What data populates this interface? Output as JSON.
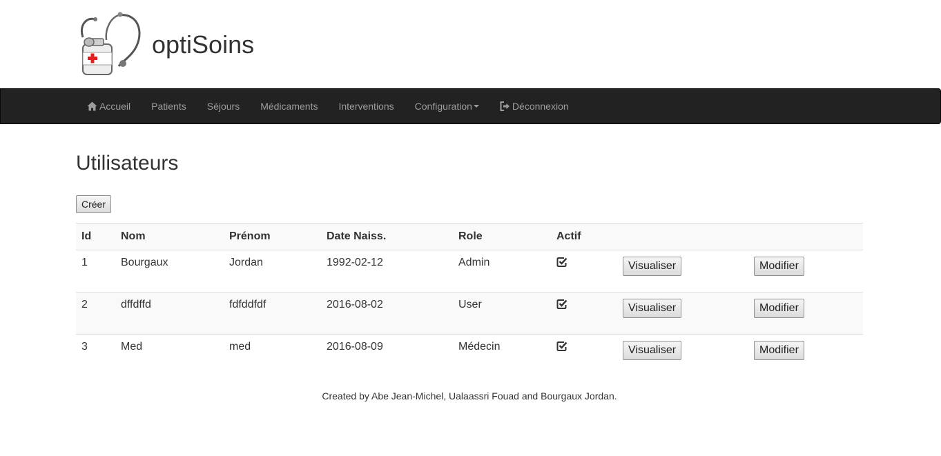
{
  "brand": {
    "name": "optiSoins"
  },
  "nav": {
    "items": [
      {
        "label": "Accueil",
        "icon": "home-icon"
      },
      {
        "label": "Patients"
      },
      {
        "label": "Séjours"
      },
      {
        "label": "Médicaments"
      },
      {
        "label": "Interventions"
      },
      {
        "label": "Configuration",
        "icon": "caret-down-icon"
      },
      {
        "label": "Déconnexion",
        "icon": "logout-icon"
      }
    ]
  },
  "page": {
    "title": "Utilisateurs",
    "create_label": "Créer"
  },
  "table": {
    "headers": [
      "Id",
      "Nom",
      "Prénom",
      "Date Naiss.",
      "Role",
      "Actif"
    ],
    "rows": [
      {
        "id": "1",
        "nom": "Bourgaux",
        "prenom": "Jordan",
        "date": "1992-02-12",
        "role": "Admin"
      },
      {
        "id": "2",
        "nom": "dffdffd",
        "prenom": "fdfddfdf",
        "date": "2016-08-02",
        "role": "User"
      },
      {
        "id": "3",
        "nom": "Med",
        "prenom": "med",
        "date": "2016-08-09",
        "role": "Médecin"
      }
    ],
    "view_label": "Visualiser",
    "edit_label": "Modifier"
  },
  "footer": {
    "text": "Created by Abe Jean-Michel, Ualaassri Fouad and Bourgaux Jordan."
  },
  "colors": {
    "navbar": "#222222",
    "nav_text": "#9d9d9d",
    "text": "#333333",
    "logo_cross": "#e02020"
  }
}
